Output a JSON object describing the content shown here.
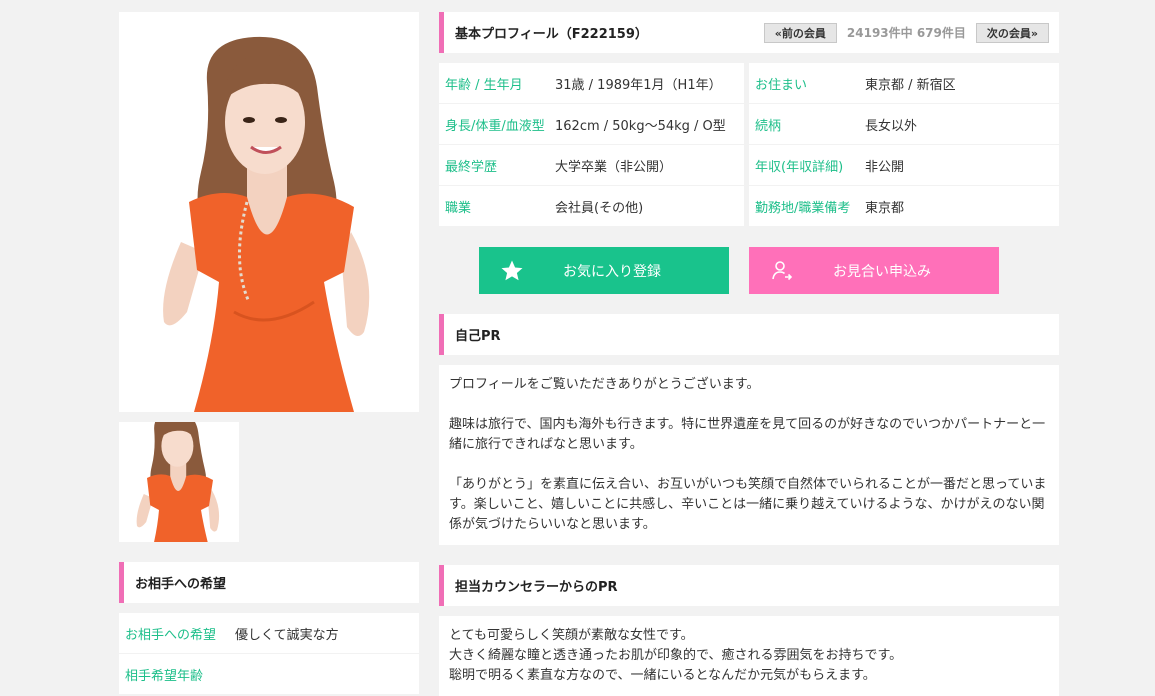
{
  "profile": {
    "title": "基本プロフィール（F222159）",
    "prev_label": "«前の会員",
    "count_text": "24193件中 679件目",
    "next_label": "次の会員»",
    "fields": [
      {
        "label": "年齢 / 生年月",
        "value": "31歳 / 1989年1月（H1年）"
      },
      {
        "label": "お住まい",
        "value": "東京都 / 新宿区"
      },
      {
        "label": "身長/体重/血液型",
        "value": "162cm / 50kg〜54kg / O型"
      },
      {
        "label": "続柄",
        "value": "長女以外"
      },
      {
        "label": "最終学歴",
        "value": "大学卒業（非公開）"
      },
      {
        "label": "年収(年収詳細)",
        "value": "非公開"
      },
      {
        "label": "職業",
        "value": "会社員(その他)"
      },
      {
        "label": "勤務地/職業備考",
        "value": "東京都"
      }
    ]
  },
  "actions": {
    "favorite_label": "お気に入り登録",
    "apply_label": "お見合い申込み"
  },
  "self_pr": {
    "heading": "自己PR",
    "paragraphs": [
      "プロフィールをご覧いただきありがとうございます。",
      "趣味は旅行で、国内も海外も行きます。特に世界遺産を見て回るのが好きなのでいつかパートナーと一緒に旅行できればなと思います。",
      "「ありがとう」を素直に伝え合い、お互いがいつも笑顔で自然体でいられることが一番だと思っています。楽しいこと、嬉しいことに共感し、辛いことは一緒に乗り越えていけるような、かけがえのない関係が気づけたらいいなと思います。"
    ]
  },
  "counselor_pr": {
    "heading": "担当カウンセラーからのPR",
    "lines": [
      "とても可愛らしく笑顔が素敵な女性です。",
      "大きく綺麗な瞳と透き通ったお肌が印象的で、癒される雰囲気をお持ちです。",
      "聡明で明るく素直な方なので、一緒にいるとなんだか元気がもらえます。"
    ]
  },
  "wish": {
    "heading": "お相手への希望",
    "rows": [
      {
        "label": "お相手への希望",
        "value": "優しくて誠実な方"
      },
      {
        "label": "相手希望年齢",
        "value": ""
      }
    ]
  },
  "colors": {
    "accent_pink": "#f06eb6",
    "label_green": "#1ebf8a",
    "favorite_button": "#19c38c",
    "apply_button": "#ff70b9",
    "dress_orange": "#f0622a"
  }
}
